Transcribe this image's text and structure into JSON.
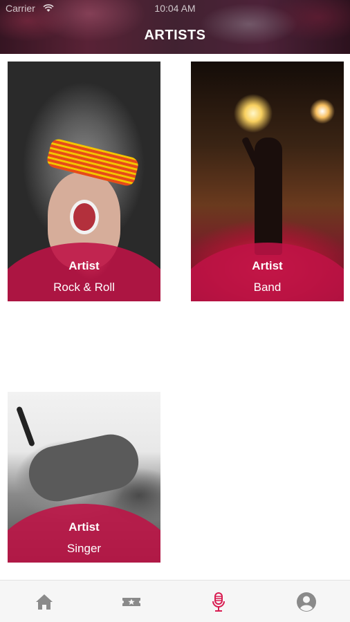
{
  "status_bar": {
    "carrier": "Carrier",
    "time": "10:04 AM"
  },
  "header": {
    "title": "ARTISTS"
  },
  "artists": [
    {
      "role": "Artist",
      "genre": "Rock & Roll"
    },
    {
      "role": "Artist",
      "genre": "Band"
    },
    {
      "role": "Artist",
      "genre": "Singer"
    }
  ],
  "tab_bar": {
    "tabs": [
      {
        "icon": "home-icon",
        "active": false
      },
      {
        "icon": "ticket-icon",
        "active": false
      },
      {
        "icon": "microphone-icon",
        "active": true
      },
      {
        "icon": "profile-icon",
        "active": false
      }
    ],
    "active_color": "#d81b50",
    "inactive_color": "#8a8a8a"
  },
  "colors": {
    "overlay": "#be1246"
  }
}
